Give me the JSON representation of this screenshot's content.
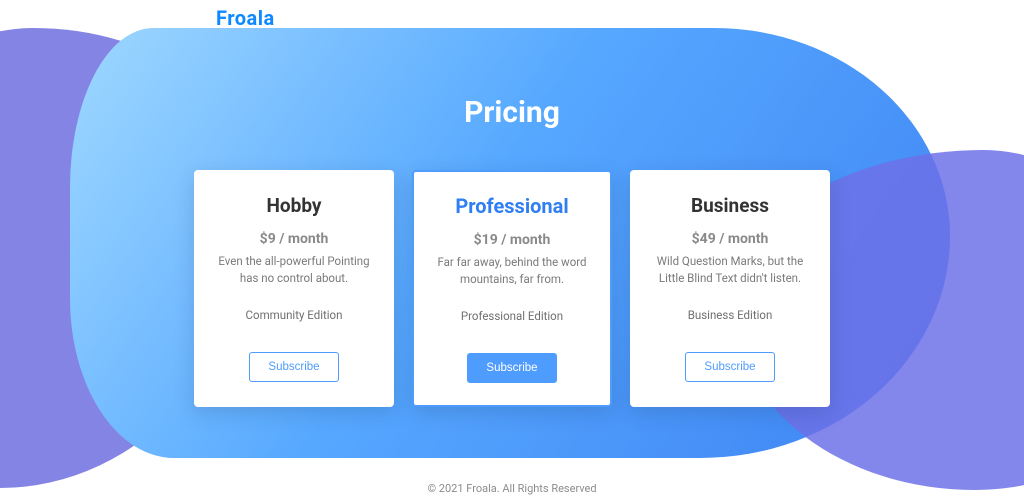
{
  "brand": {
    "name": "Froala"
  },
  "header": {
    "title": "Pricing"
  },
  "plans": [
    {
      "name": "Hobby",
      "price": "$9 / month",
      "desc": "Even the all-powerful Pointing has no control about.",
      "edition": "Community Edition",
      "cta": "Subscribe",
      "featured": false
    },
    {
      "name": "Professional",
      "price": "$19 / month",
      "desc": "Far far away, behind the word mountains, far from.",
      "edition": "Professional Edition",
      "cta": "Subscribe",
      "featured": true
    },
    {
      "name": "Business",
      "price": "$49 / month",
      "desc": "Wild Question Marks, but the Little Blind Text didn't listen.",
      "edition": "Business Edition",
      "cta": "Subscribe",
      "featured": false
    }
  ],
  "footer": {
    "text": "© 2021 Froala. All Rights Reserved"
  }
}
